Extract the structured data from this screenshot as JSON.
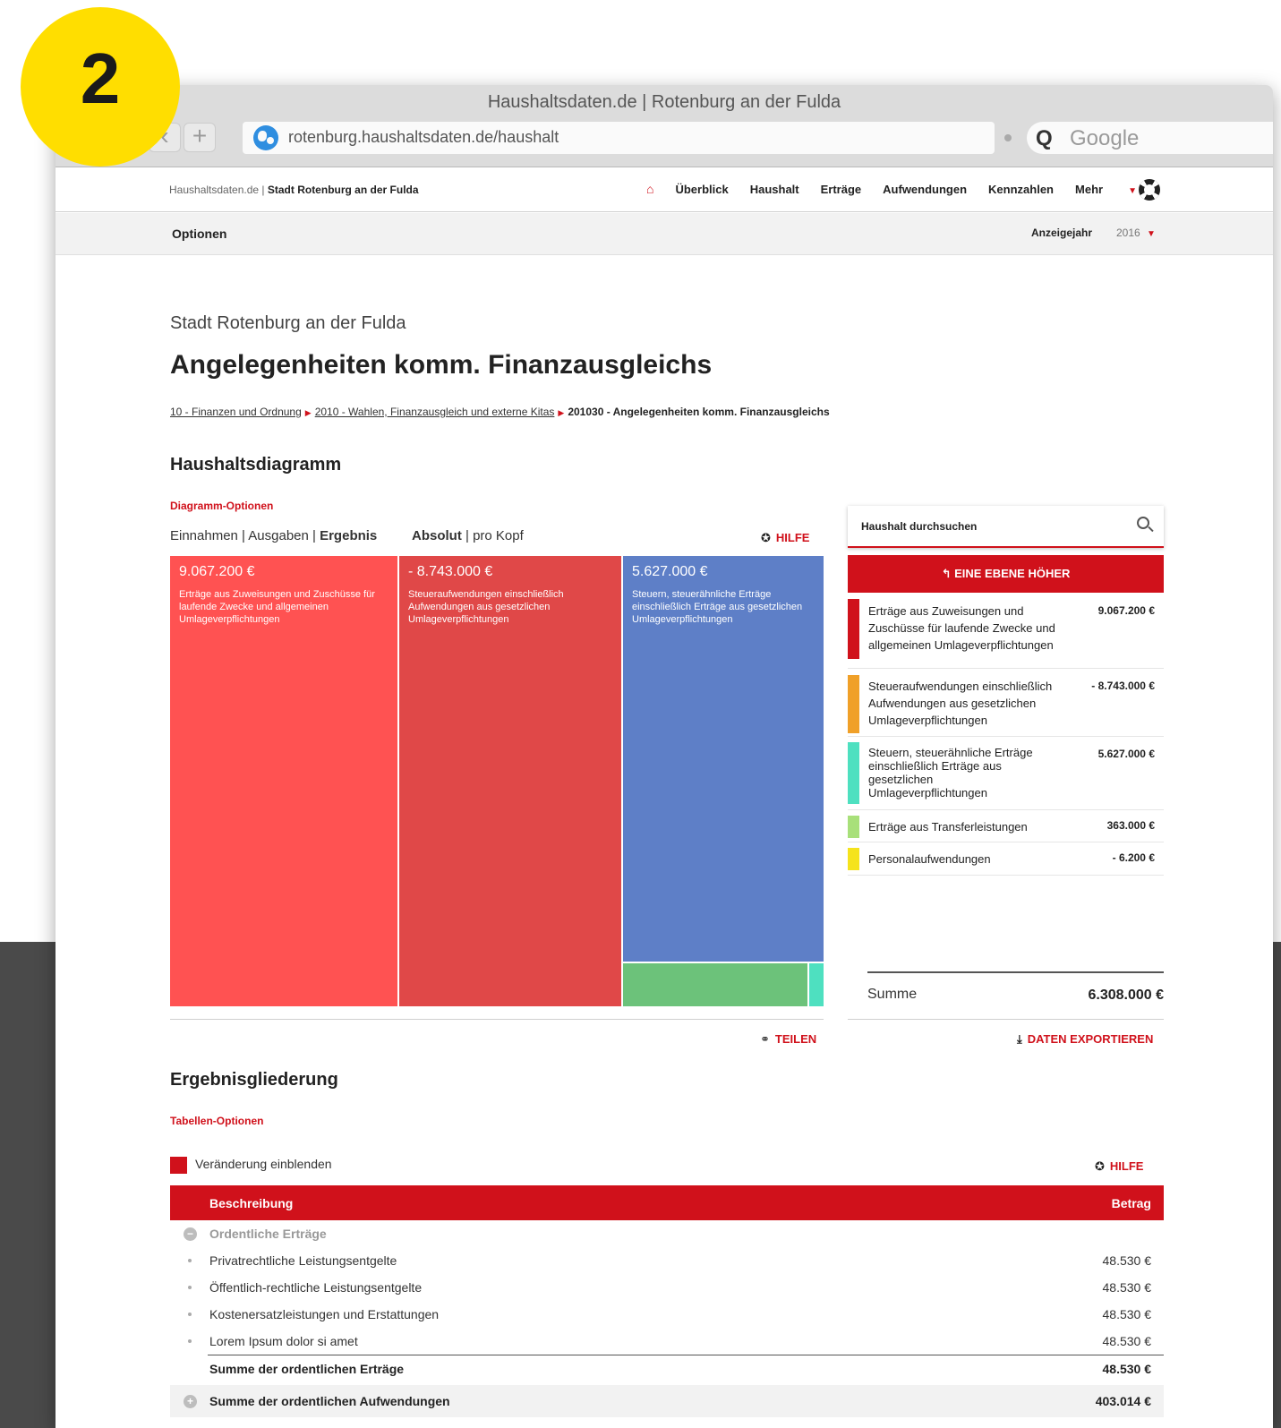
{
  "badge": {
    "number": "2"
  },
  "browser": {
    "window_title": "Haushaltsdaten.de | Rotenburg an der Fulda",
    "url": "rotenburg.haushaltsdaten.de/haushalt",
    "search_placeholder": "Google",
    "back_icon": "chevron-left-icon",
    "new_tab_icon": "plus-icon"
  },
  "topnav": {
    "brand_prefix": "Haushaltsdaten.de | ",
    "brand_city": "Stadt Rotenburg an der Fulda",
    "items": [
      {
        "label": "Überblick"
      },
      {
        "label": "Haushalt"
      },
      {
        "label": "Erträge"
      },
      {
        "label": "Aufwendungen"
      },
      {
        "label": "Kennzahlen"
      },
      {
        "label": "Mehr"
      }
    ]
  },
  "optbar": {
    "options_label": "Optionen",
    "year_label": "Anzeigejahr",
    "year_value": "2016"
  },
  "page": {
    "subtitle": "Stadt Rotenburg an der Fulda",
    "title": "Angelegenheiten komm. Finanzausgleichs",
    "breadcrumb": [
      "10 - Finanzen und Ordnung",
      "2010 - Wahlen, Finanzausgleich und externe Kitas",
      "201030 - Angelegenheiten komm. Finanzausgleichs"
    ]
  },
  "diagram": {
    "section_title": "Haushaltsdiagramm",
    "options_label": "Diagramm-Optionen",
    "toggle_einnahmen": "Einnahmen",
    "toggle_ausgaben": "Ausgaben",
    "toggle_ergebnis": "Ergebnis",
    "toggle_absolut": "Absolut",
    "toggle_prokopf": "pro Kopf",
    "sep": " | ",
    "help_label": "HILFE",
    "share_label": "TEILEN",
    "export_label": "DATEN EXPORTIEREN",
    "tiles": [
      {
        "value": "9.067.200 €",
        "desc": "Erträge aus Zuweisungen und Zuschüsse für laufende Zwecke und allgemeinen Umlageverpflichtungen",
        "color": "#ff5252"
      },
      {
        "value": "- 8.743.000 €",
        "desc": "Steueraufwendungen einschließlich Aufwendungen aus gesetzlichen Umlageverpflichtungen",
        "color": "#e04848"
      },
      {
        "value": "5.627.000 €",
        "desc": "Steuern, steuerähnliche Erträge einschließlich Erträge aus gesetzlichen Umlageverpflichtungen",
        "color": "#5e7fc7"
      },
      {
        "value": "",
        "desc": "",
        "color": "#6cc27a"
      },
      {
        "value": "",
        "desc": "",
        "color": "#4ee0c0"
      }
    ]
  },
  "sidebar": {
    "search_label": "Haushalt durchsuchen",
    "up_button": "EINE EBENE HÖHER",
    "legend": [
      {
        "label": "Erträge aus Zuweisungen und Zuschüsse für laufende Zwecke und allgemeinen Umlageverpflichtungen",
        "value": "9.067.200 €",
        "color": "#d0111b"
      },
      {
        "label": "Steueraufwendungen einschließlich Aufwendungen aus gesetzlichen Umlageverpflichtungen",
        "value": "- 8.743.000 €",
        "color": "#f0a028"
      },
      {
        "label": "Steuern, steuerähnliche Erträge einschließlich Erträge aus gesetzlichen Umlageverpflichtungen",
        "value": "5.627.000 €",
        "color": "#4ee0c0"
      },
      {
        "label": "Erträge aus Transferleistungen",
        "value": "363.000 €",
        "color": "#a8e07a"
      },
      {
        "label": "Personalaufwendungen",
        "value": "- 6.200 €",
        "color": "#f5e31c"
      }
    ],
    "sum_label": "Summe",
    "sum_value": "6.308.000 €"
  },
  "results": {
    "section_title": "Ergebnisgliederung",
    "options_label": "Tabellen-Optionen",
    "checkbox_label": "Veränderung einblenden",
    "help_label": "HILFE",
    "col_desc": "Beschreibung",
    "col_amount": "Betrag",
    "group_label": "Ordentliche Erträge",
    "rows": [
      {
        "desc": "Privatrechtliche Leistungsentgelte",
        "amount": "48.530 €"
      },
      {
        "desc": "Öffentlich-rechtliche Leistungsentgelte",
        "amount": "48.530 €"
      },
      {
        "desc": "Kostenersatzleistungen und Erstattungen",
        "amount": "48.530 €"
      },
      {
        "desc": "Lorem Ipsum dolor si amet",
        "amount": "48.530 €"
      }
    ],
    "sum_row": {
      "desc": "Summe der ordentlichen Erträge",
      "amount": "48.530 €"
    },
    "collapsed_row": {
      "desc": "Summe der ordentlichen Aufwendungen",
      "amount": "403.014 €"
    }
  }
}
